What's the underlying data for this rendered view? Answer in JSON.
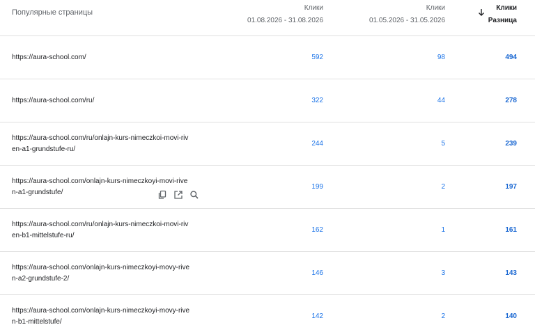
{
  "header": {
    "title": "Популярные страницы",
    "col1_label": "Клики",
    "col1_range": "01.08.2026 - 31.08.2026",
    "col2_label": "Клики",
    "col2_range": "01.05.2026 - 31.05.2026",
    "col3_label": "Клики",
    "col3_sub": "Разница",
    "sort_icon": "arrow-down-icon"
  },
  "rows": [
    {
      "url_line1": "https://aura-school.com/",
      "url_line2": "",
      "current": "592",
      "previous": "98",
      "diff": "494"
    },
    {
      "url_line1": "https://aura-school.com/ru/",
      "url_line2": "",
      "current": "322",
      "previous": "44",
      "diff": "278"
    },
    {
      "url_line1": "https://aura-school.com/ru/onlajn-kurs-nimeczkoi-movi-riv",
      "url_line2": "en-a1-grundstufe-ru/",
      "current": "244",
      "previous": "5",
      "diff": "239"
    },
    {
      "url_line1": "https://aura-school.com/onlajn-kurs-nimeczkoyi-movi-rive",
      "url_line2": "n-a1-grundstufe/",
      "current": "199",
      "previous": "2",
      "diff": "197"
    },
    {
      "url_line1": "https://aura-school.com/ru/onlajn-kurs-nimeczkoi-movi-riv",
      "url_line2": "en-b1-mittelstufe-ru/",
      "current": "162",
      "previous": "1",
      "diff": "161"
    },
    {
      "url_line1": "https://aura-school.com/onlajn-kurs-nimeczkoyi-movy-rive",
      "url_line2": "n-a2-grundstufe-2/",
      "current": "146",
      "previous": "3",
      "diff": "143"
    },
    {
      "url_line1": "https://aura-school.com/onlajn-kurs-nimeczkoyi-movy-rive",
      "url_line2": "n-b1-mittelstufe/",
      "current": "142",
      "previous": "2",
      "diff": "140"
    }
  ],
  "row_actions": {
    "icons": [
      "copy-icon",
      "open-in-new-icon",
      "search-icon"
    ]
  },
  "colors": {
    "link_blue": "#1a73e8",
    "diff_blue": "#1967d2",
    "divider": "#e0e0e0",
    "muted_text": "#5f6368"
  }
}
